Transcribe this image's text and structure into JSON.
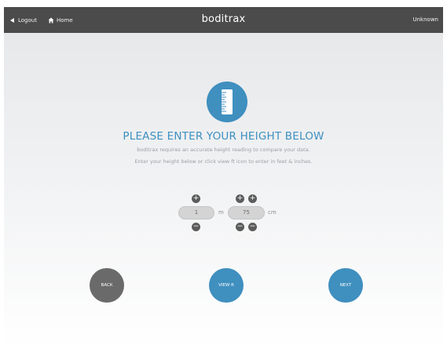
{
  "header": {
    "logout_label": "Logout",
    "home_label": "Home",
    "brand": "boditrax",
    "user_label": "Unknown"
  },
  "main": {
    "title": "PLEASE ENTER YOUR HEIGHT BELOW",
    "subtitle_line1": "boditrax requires an accurate height reading to compare your data.",
    "subtitle_line2": "Enter your height below or click view ft icon to enter in feet & inches."
  },
  "height_input": {
    "meters_value": "1",
    "meters_unit": "m",
    "centimeters_value": "75",
    "centimeters_unit": "cm"
  },
  "actions": {
    "back_label": "BACK",
    "view_ft_label": "VIEW ft",
    "next_label": "NEXT"
  },
  "colors": {
    "header_bg": "#4b4b4b",
    "accent_blue": "#3f8fbf",
    "back_gray": "#6a6a6a",
    "stepper_gray": "#5c5c5c"
  },
  "icons": {
    "logout": "arrow-left-icon",
    "home": "home-icon",
    "hero": "ruler-icon",
    "increment": "plus-icon",
    "decrement": "minus-icon"
  }
}
